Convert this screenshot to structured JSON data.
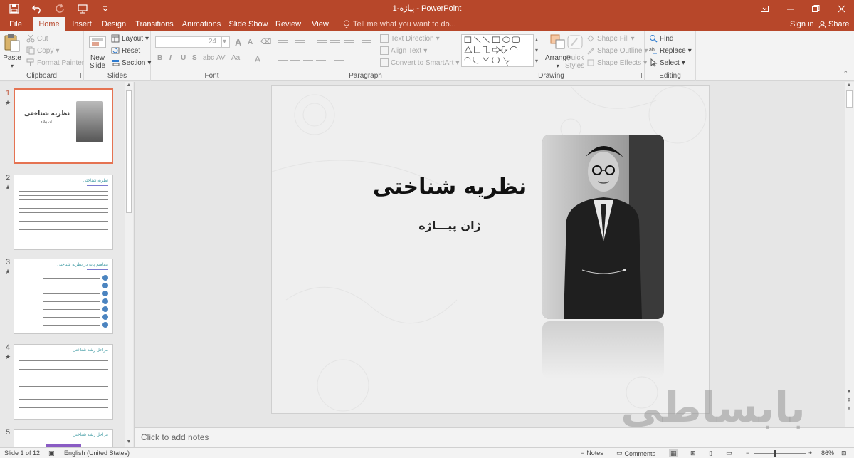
{
  "app": {
    "title": "پیاژه-1 - PowerPoint"
  },
  "quick_access": [
    {
      "name": "save-icon"
    },
    {
      "name": "undo-icon"
    },
    {
      "name": "redo-icon"
    },
    {
      "name": "present-from-start-icon"
    },
    {
      "name": "customize-qat-icon"
    }
  ],
  "tabs": [
    "File",
    "Home",
    "Insert",
    "Design",
    "Transitions",
    "Animations",
    "Slide Show",
    "Review",
    "View"
  ],
  "tell_me": "Tell me what you want to do...",
  "account": {
    "sign_in": "Sign in",
    "share": "Share"
  },
  "ribbon": {
    "clipboard": {
      "label": "Clipboard",
      "paste": "Paste",
      "cut": "Cut",
      "copy": "Copy",
      "format_painter": "Format Painter"
    },
    "slides": {
      "label": "Slides",
      "new_slide_line1": "New",
      "new_slide_line2": "Slide",
      "layout": "Layout",
      "reset": "Reset",
      "section": "Section"
    },
    "font": {
      "label": "Font",
      "font_name": "",
      "font_size": "24",
      "bold": "B",
      "italic": "I",
      "underline": "U",
      "shadow": "S",
      "strike": "abc",
      "spacing": "AV",
      "case": "Aa",
      "color": "A",
      "grow": "A",
      "shrink": "A"
    },
    "paragraph": {
      "label": "Paragraph",
      "text_direction": "Text Direction",
      "align_text": "Align Text",
      "convert_smartart": "Convert to SmartArt"
    },
    "drawing": {
      "label": "Drawing",
      "arrange": "Arrange",
      "quick_styles_line1": "Quick",
      "quick_styles_line2": "Styles",
      "shape_fill": "Shape Fill",
      "shape_outline": "Shape Outline",
      "shape_effects": "Shape Effects"
    },
    "editing": {
      "label": "Editing",
      "find": "Find",
      "replace": "Replace",
      "select": "Select"
    }
  },
  "thumbnails": [
    {
      "number": "1",
      "title": "نظریه شناختی",
      "subtitle": "ژان پیاژه",
      "selected": true
    },
    {
      "number": "2",
      "title": "نظریه شناختی",
      "subtitle": "",
      "selected": false
    },
    {
      "number": "3",
      "title": "مفاهیم پایه در نظریه شناختی",
      "subtitle": "",
      "selected": false
    },
    {
      "number": "4",
      "title": "مراحل رشد شناختی",
      "subtitle": "",
      "selected": false
    },
    {
      "number": "5",
      "title": "مراحل رشد شناختی",
      "subtitle": "",
      "selected": false
    }
  ],
  "slide": {
    "title": "نظریه شناختی",
    "subtitle": "ژان پیـــاژه"
  },
  "notes_placeholder": "Click to add notes",
  "status": {
    "slide_indicator": "Slide 1 of 12",
    "language": "English (United States)",
    "notes": "Notes",
    "comments": "Comments",
    "zoom": "86%"
  },
  "watermark": "بابساطی",
  "colors": {
    "accent": "#b7472a",
    "selection": "#e57352"
  }
}
